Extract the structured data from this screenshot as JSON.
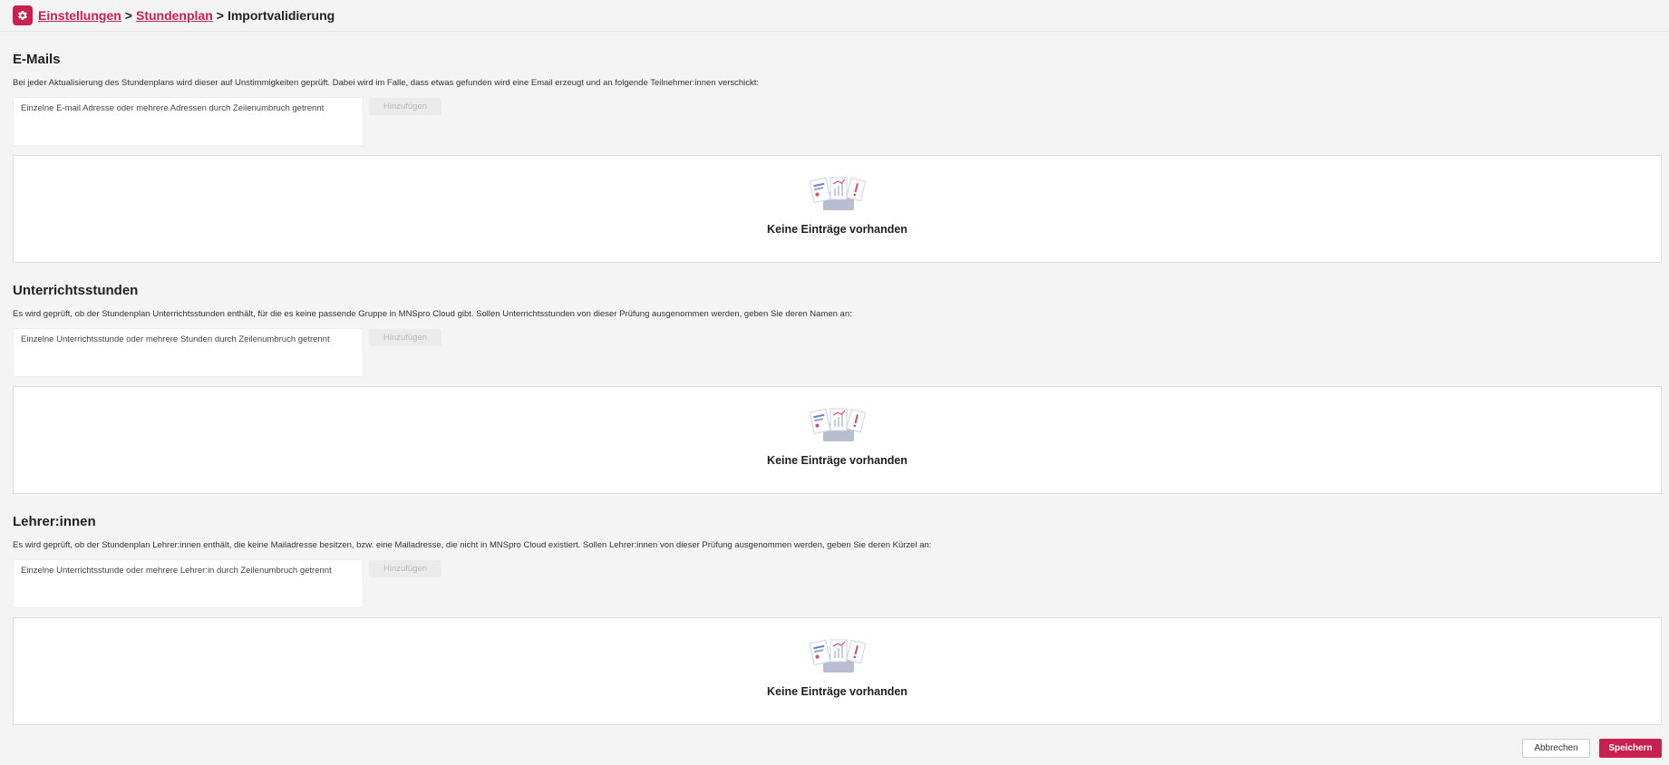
{
  "breadcrumb": {
    "items": [
      "Einstellungen",
      "Stundenplan"
    ],
    "separator": ">",
    "current": "Importvalidierung"
  },
  "colors": {
    "accent": "#c8204f"
  },
  "sections": [
    {
      "title": "E-Mails",
      "description": "Bei jeder Aktualisierung des Stundenplans wird dieser auf Unstimmigkeiten geprüft. Dabei wird im Falle, dass etwas gefunden wird eine Email erzeugt und an folgende Teilnehmer:innen verschickt:",
      "placeholder": "Einzelne E-mail Adresse oder mehrere Adressen durch Zeilenumbruch getrennt",
      "add_label": "Hinzufügen",
      "empty_text": "Keine Einträge vorhanden"
    },
    {
      "title": "Unterrichtsstunden",
      "description": "Es wird geprüft, ob der Stundenplan Unterrichtsstunden enthält, für die es keine passende Gruppe in MNSpro Cloud gibt. Sollen Unterrichtsstunden von dieser Prüfung ausgenommen werden, geben Sie deren Namen an:",
      "placeholder": "Einzelne Unterrichtsstunde oder mehrere Stunden durch Zeilenumbruch getrennt",
      "add_label": "Hinzufügen",
      "empty_text": "Keine Einträge vorhanden"
    },
    {
      "title": "Lehrer:innen",
      "description": "Es wird geprüft, ob der Stundenplan Lehrer:innen enthält, die keine Mailadresse besitzen, bzw. eine Mailadresse, die nicht in MNSpro Cloud existiert. Sollen Lehrer:innen von dieser Prüfung ausgenommen werden, geben Sie deren Kürzel an:",
      "placeholder": "Einzelne Unterrichtsstunde oder mehrere Lehrer:in durch Zeilenumbruch getrennt",
      "add_label": "Hinzufügen",
      "empty_text": "Keine Einträge vorhanden"
    }
  ],
  "footer": {
    "cancel_label": "Abbrechen",
    "save_label": "Speichern"
  }
}
